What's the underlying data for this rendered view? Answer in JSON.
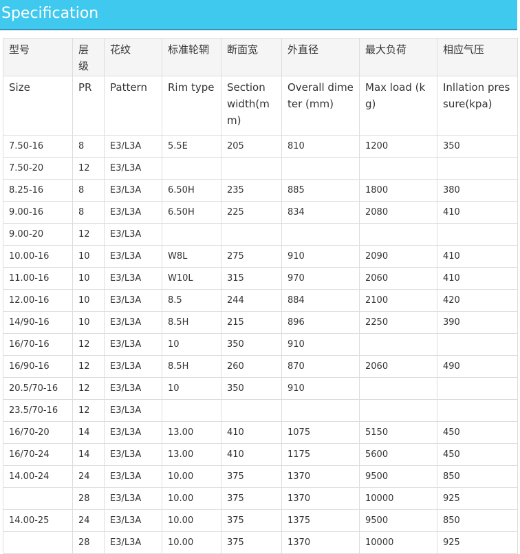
{
  "banner": {
    "title": "Specification"
  },
  "table": {
    "header_cn": [
      "型号",
      "层级",
      "花纹",
      "标准轮辋",
      "断面宽",
      "外直径",
      "最大负荷",
      "相应气压"
    ],
    "header_en": [
      "Size",
      "PR",
      "Pattern",
      "Rim type",
      "Section width(mm)",
      "Overall dimeter (mm)",
      "Max load (kg)",
      "Inllation pressure(kpa)"
    ],
    "rows": [
      [
        "7.50-16",
        "8",
        "E3/L3A",
        "5.5E",
        "205",
        "810",
        "1200",
        "350"
      ],
      [
        "7.50-20",
        "12",
        "E3/L3A",
        "",
        "",
        "",
        "",
        ""
      ],
      [
        "8.25-16",
        "8",
        "E3/L3A",
        "6.50H",
        "235",
        "885",
        "1800",
        "380"
      ],
      [
        "9.00-16",
        "8",
        "E3/L3A",
        "6.50H",
        "225",
        "834",
        "2080",
        "410"
      ],
      [
        "9.00-20",
        "12",
        "E3/L3A",
        "",
        "",
        "",
        "",
        ""
      ],
      [
        "10.00-16",
        "10",
        "E3/L3A",
        "W8L",
        "275",
        "910",
        "2090",
        "410"
      ],
      [
        "11.00-16",
        "10",
        "E3/L3A",
        "W10L",
        "315",
        "970",
        "2060",
        "410"
      ],
      [
        "12.00-16",
        "10",
        "E3/L3A",
        "8.5",
        "244",
        "884",
        "2100",
        "420"
      ],
      [
        "14/90-16",
        "10",
        "E3/L3A",
        "8.5H",
        "215",
        "896",
        "2250",
        "390"
      ],
      [
        "16/70-16",
        "12",
        "E3/L3A",
        "10",
        "350",
        "910",
        "",
        ""
      ],
      [
        "16/90-16",
        "12",
        "E3/L3A",
        "8.5H",
        "260",
        "870",
        "2060",
        "490"
      ],
      [
        "20.5/70-16",
        "12",
        "E3/L3A",
        "10",
        "350",
        "910",
        "",
        ""
      ],
      [
        "23.5/70-16",
        "12",
        "E3/L3A",
        "",
        "",
        "",
        "",
        ""
      ],
      [
        "16/70-20",
        "14",
        "E3/L3A",
        "13.00",
        "410",
        "1075",
        "5150",
        "450"
      ],
      [
        "16/70-24",
        "14",
        "E3/L3A",
        "13.00",
        "410",
        "1175",
        "5600",
        "450"
      ],
      [
        "14.00-24",
        "24",
        "E3/L3A",
        "10.00",
        "375",
        "1370",
        "9500",
        "850"
      ],
      [
        "",
        "28",
        "E3/L3A",
        "10.00",
        "375",
        "1370",
        "10000",
        "925"
      ],
      [
        "14.00-25",
        "24",
        "E3/L3A",
        "10.00",
        "375",
        "1375",
        "9500",
        "850"
      ],
      [
        "",
        "28",
        "E3/L3A",
        "10.00",
        "375",
        "1370",
        "10000",
        "925"
      ]
    ]
  }
}
